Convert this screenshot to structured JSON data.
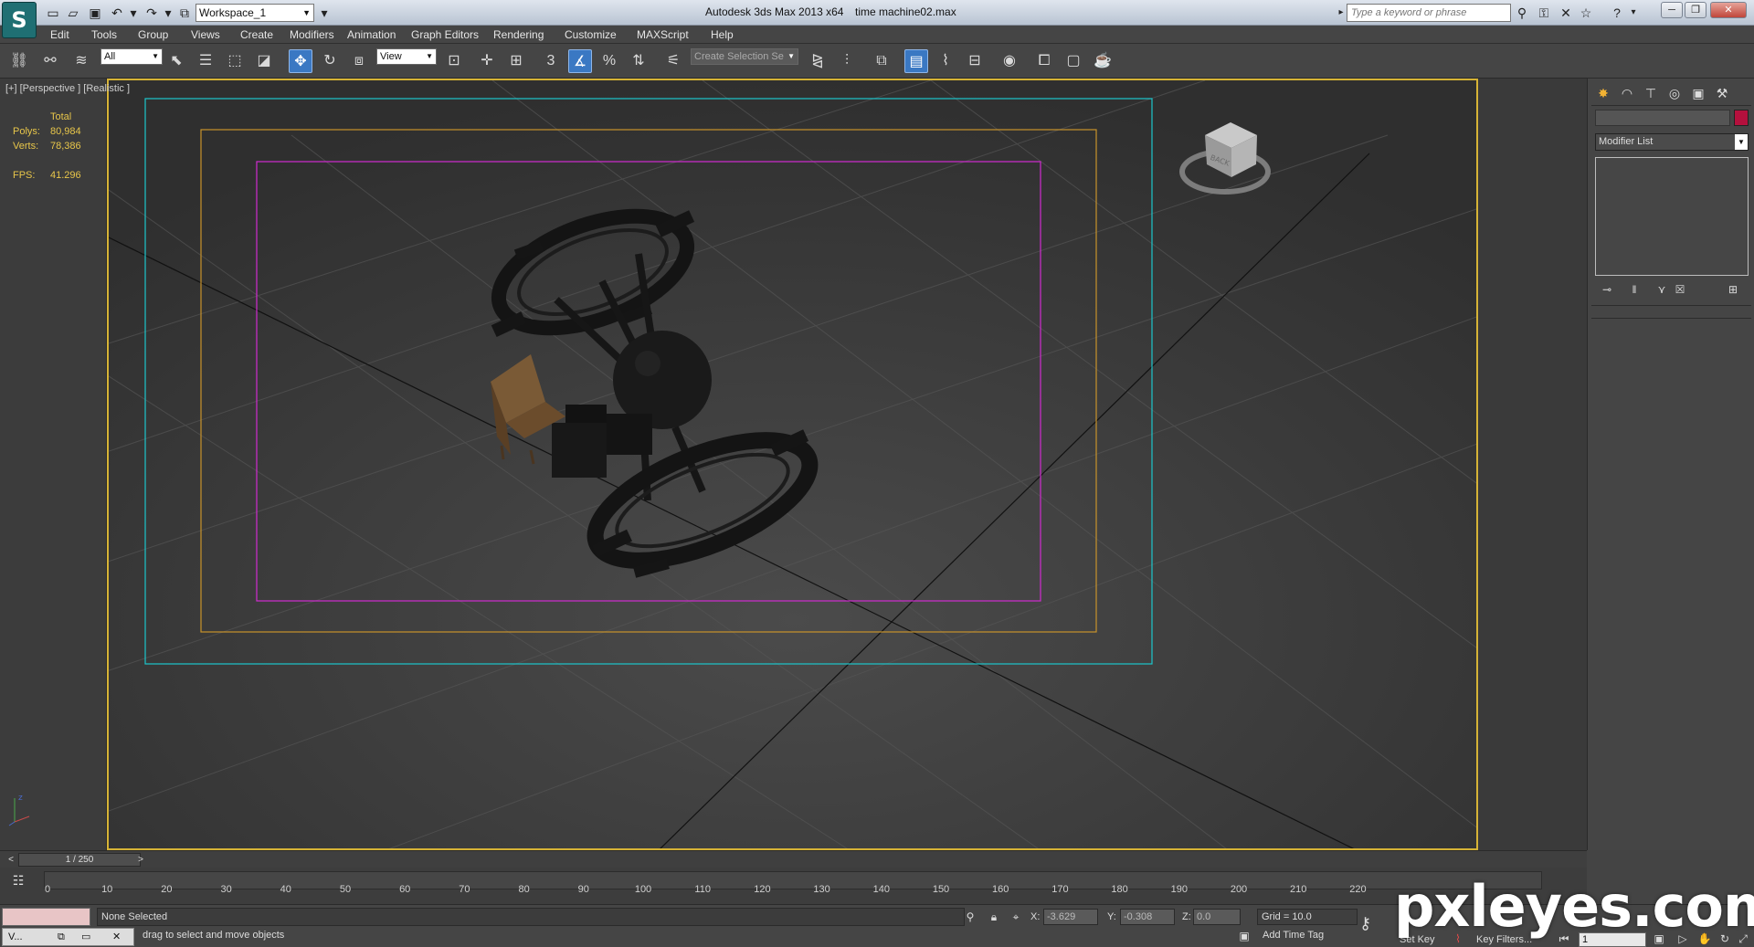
{
  "titlebar": {
    "app_title": "Autodesk 3ds Max  2013 x64",
    "file_name": "time machine02.max",
    "workspace": "Workspace_1",
    "search_placeholder": "Type a keyword or phrase",
    "logo_glyph": "S"
  },
  "menu": {
    "items": [
      "Edit",
      "Tools",
      "Group",
      "Views",
      "Create",
      "Modifiers",
      "Animation",
      "Graph Editors",
      "Rendering",
      "Customize",
      "MAXScript",
      "Help"
    ]
  },
  "toolbar": {
    "selection_filter": "All",
    "reference_coord": "View",
    "selection_set_placeholder": "Create Selection Se",
    "snap_3": "3",
    "angle_snap": "%",
    "active_tool": "select-and-move"
  },
  "viewport": {
    "label": "[+] [Perspective ] [Realistic ]",
    "stats_header": "Total",
    "polys_label": "Polys:",
    "polys_value": "80,984",
    "verts_label": "Verts:",
    "verts_value": "78,386",
    "fps_label": "FPS:",
    "fps_value": "41.296",
    "viewcube_text": "BACK",
    "frame_colors": {
      "viewport_border": "#d6b336",
      "cyan": "#1cc6cc",
      "orange": "#c8932b",
      "magenta": "#d02bd0"
    }
  },
  "command_panel": {
    "modifier_list": "Modifier List",
    "color_swatch": "#b5103d"
  },
  "timeline": {
    "frame_display": "1 / 250",
    "ticks": [
      "0",
      "10",
      "20",
      "30",
      "40",
      "50",
      "60",
      "70",
      "80",
      "90",
      "100",
      "110",
      "120",
      "130",
      "140",
      "150",
      "160",
      "170",
      "180",
      "190",
      "200",
      "210",
      "220"
    ]
  },
  "status": {
    "selection": "None Selected",
    "prompt": "drag to select and move objects",
    "taskbar_item": "V...",
    "x_label": "X:",
    "x_value": "-3.629",
    "y_label": "Y:",
    "y_value": "-0.308",
    "z_label": "Z:",
    "z_value": "0.0",
    "grid": "Grid = 10.0",
    "add_time_tag": "Add Time Tag",
    "set_key": "Set Key",
    "key_filters": "Key Filters...",
    "frame": "1"
  },
  "watermark": "pxleyes.com"
}
